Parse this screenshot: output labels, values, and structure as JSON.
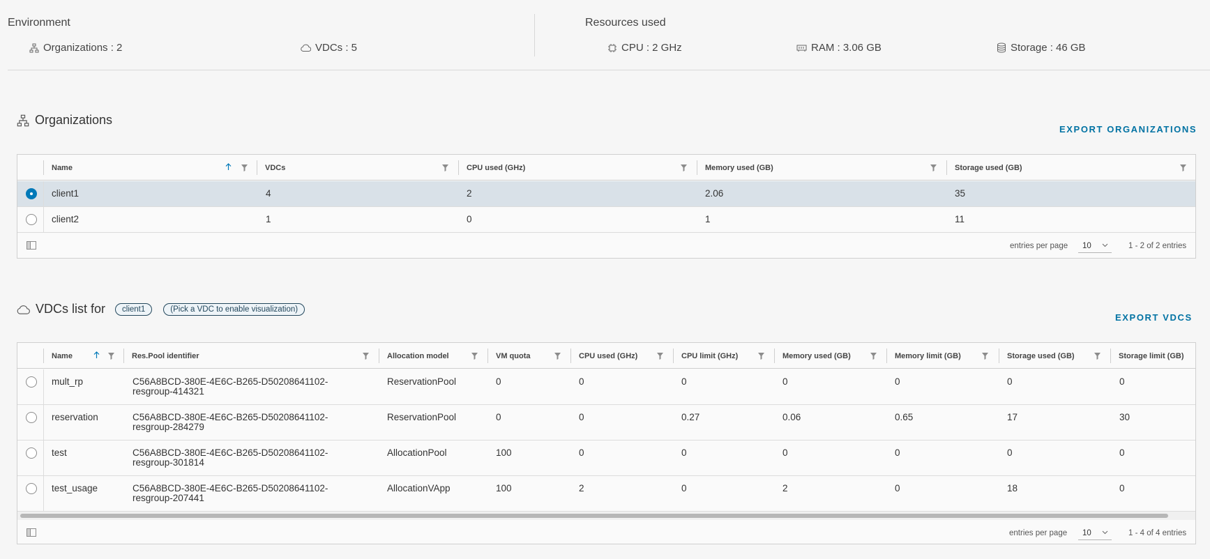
{
  "environment": {
    "heading": "Environment",
    "orgs": "Organizations : 2",
    "vdcs": "VDCs : 5"
  },
  "resources": {
    "heading": "Resources used",
    "cpu": "CPU : 2 GHz",
    "ram": "RAM : 3.06 GB",
    "storage": "Storage : 46 GB"
  },
  "organizations": {
    "title": "Organizations",
    "export": "EXPORT ORGANIZATIONS",
    "columns": [
      "Name",
      "VDCs",
      "CPU used (GHz)",
      "Memory used (GB)",
      "Storage used (GB)"
    ],
    "rows": [
      {
        "name": "client1",
        "vdcs": "4",
        "cpu": "2",
        "mem": "2.06",
        "storage": "35",
        "selected": true
      },
      {
        "name": "client2",
        "vdcs": "1",
        "cpu": "0",
        "mem": "1",
        "storage": "11",
        "selected": false
      }
    ],
    "footer": {
      "per_page_label": "entries per page",
      "per_page": "10",
      "range": "1 - 2 of 2 entries"
    }
  },
  "vdcs": {
    "title": "VDCs list for",
    "org_pill": "client1",
    "hint_pill": "(Pick a VDC to enable visualization)",
    "export": "EXPORT VDCS",
    "columns": [
      "Name",
      "Res.Pool identifier",
      "Allocation model",
      "VM quota",
      "CPU used (GHz)",
      "CPU limit (GHz)",
      "Memory used (GB)",
      "Memory limit (GB)",
      "Storage used (GB)",
      "Storage limit (GB)"
    ],
    "rows": [
      {
        "name": "mult_rp",
        "pool1": "C56A8BCD-380E-4E6C-B265-D50208641102-",
        "pool2": "resgroup-414321",
        "alloc": "ReservationPool",
        "quota": "0",
        "cpu_used": "0",
        "cpu_limit": "0",
        "mem_used": "0",
        "mem_limit": "0",
        "sto_used": "0",
        "sto_limit": "0"
      },
      {
        "name": "reservation",
        "pool1": "C56A8BCD-380E-4E6C-B265-D50208641102-",
        "pool2": "resgroup-284279",
        "alloc": "ReservationPool",
        "quota": "0",
        "cpu_used": "0",
        "cpu_limit": "0.27",
        "mem_used": "0.06",
        "mem_limit": "0.65",
        "sto_used": "17",
        "sto_limit": "30"
      },
      {
        "name": "test",
        "pool1": "C56A8BCD-380E-4E6C-B265-D50208641102-",
        "pool2": "resgroup-301814",
        "alloc": "AllocationPool",
        "quota": "100",
        "cpu_used": "0",
        "cpu_limit": "0",
        "mem_used": "0",
        "mem_limit": "0",
        "sto_used": "0",
        "sto_limit": "0"
      },
      {
        "name": "test_usage",
        "pool1": "C56A8BCD-380E-4E6C-B265-D50208641102-",
        "pool2": "resgroup-207441",
        "alloc": "AllocationVApp",
        "quota": "100",
        "cpu_used": "2",
        "cpu_limit": "0",
        "mem_used": "2",
        "mem_limit": "0",
        "sto_used": "18",
        "sto_limit": "0"
      }
    ],
    "footer": {
      "per_page_label": "entries per page",
      "per_page": "10",
      "range": "1 - 4 of 4 entries"
    }
  }
}
